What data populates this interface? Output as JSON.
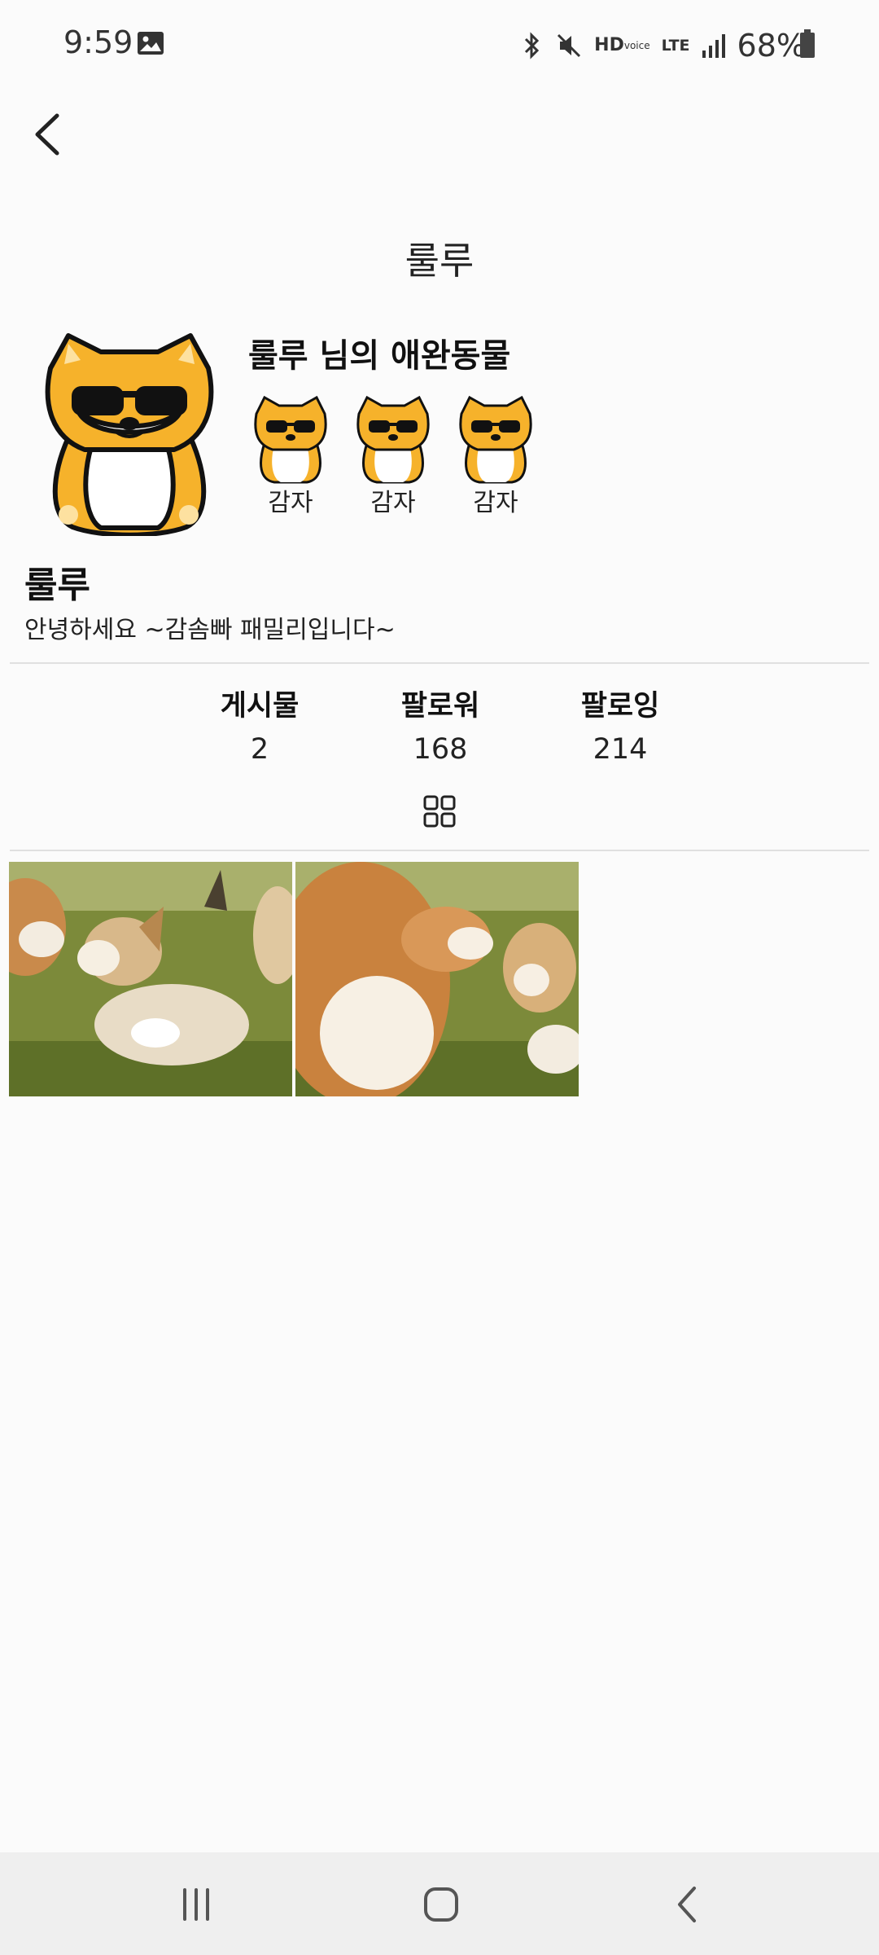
{
  "status_bar": {
    "time": "9:59",
    "hd_label": "HD",
    "voice_label": "voice",
    "lte_label": "LTE",
    "battery": "68%"
  },
  "header": {
    "title": "룰루"
  },
  "profile": {
    "pets_title": "룰루 님의 애완동물",
    "pets": [
      {
        "name": "감자"
      },
      {
        "name": "감자"
      },
      {
        "name": "감자"
      }
    ],
    "name": "룰루",
    "bio": "안녕하세요 ~감솜빠 패밀리입니다~"
  },
  "stats": {
    "posts_label": "게시물",
    "posts_value": "2",
    "followers_label": "팔로워",
    "followers_value": "168",
    "following_label": "팔로잉",
    "following_value": "214"
  },
  "posts": [
    {
      "image": "corgi-puppies-photo"
    },
    {
      "image": "corgi-puppies-photo"
    }
  ],
  "icons": {
    "back": "back-arrow-icon",
    "grid": "grid-icon",
    "nav_recent": "recent-apps-icon",
    "nav_home": "home-icon",
    "nav_back": "nav-back-icon"
  }
}
